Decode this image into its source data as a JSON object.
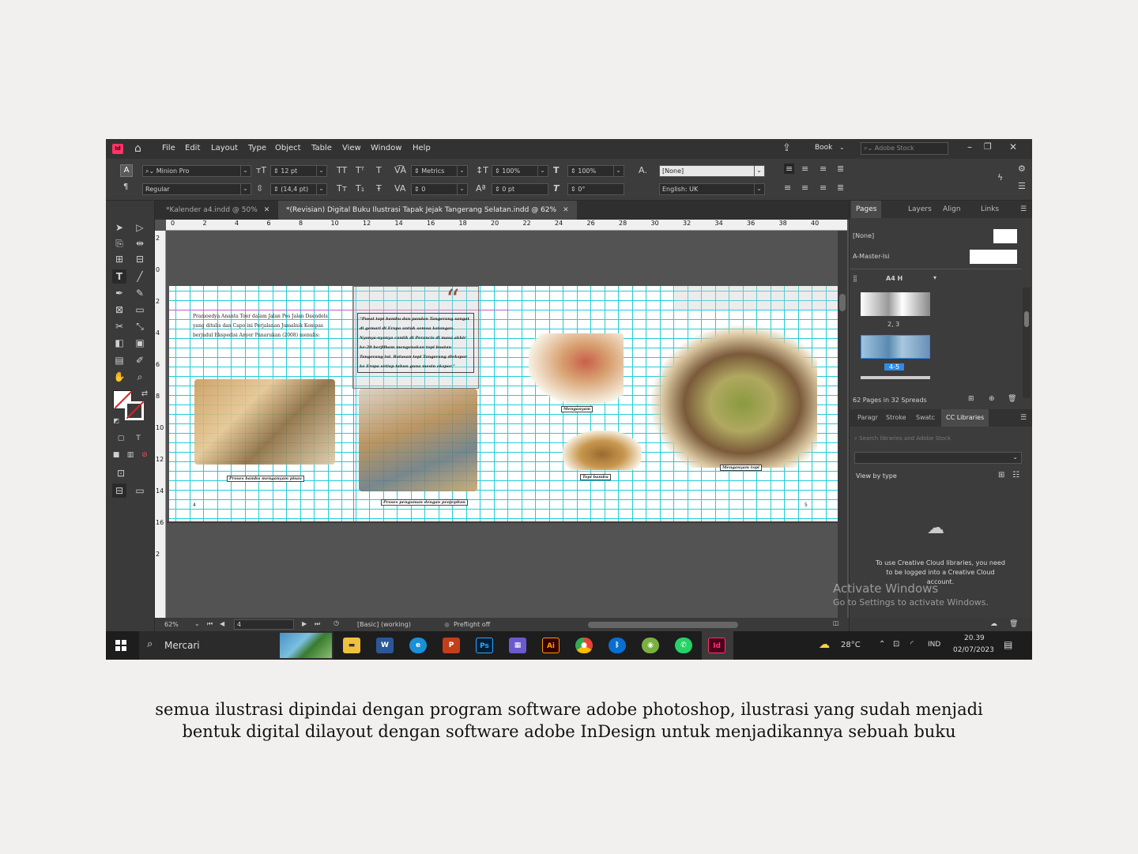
{
  "menubar": {
    "items": [
      "File",
      "Edit",
      "Layout",
      "Type",
      "Object",
      "Table",
      "View",
      "Window",
      "Help"
    ],
    "workspace": "Book",
    "search_placeholder": "Adobe Stock"
  },
  "control": {
    "font_family": "Minion Pro",
    "font_style": "Regular",
    "font_size": "12 pt",
    "leading": "(14,4 pt)",
    "kerning": "Metrics",
    "tracking": "0",
    "vscale": "100%",
    "hscale": "100%",
    "baseline": "0 pt",
    "skew": "0°",
    "char_style": "[None]",
    "language": "English: UK"
  },
  "tabs": {
    "tab1": "*Kalender a4.indd @ 50%",
    "tab2": "*(Revisian) Digital Buku Ilustrasi Tapak Jejak Tangerang Selatan.indd @ 62%"
  },
  "ruler": {
    "h": [
      "0",
      "2",
      "4",
      "6",
      "8",
      "10",
      "12",
      "14",
      "16",
      "18",
      "20",
      "22",
      "24",
      "26",
      "28",
      "30",
      "32",
      "34",
      "36",
      "38",
      "40"
    ],
    "v": [
      "2",
      "0",
      "2",
      "4",
      "6",
      "8",
      "10",
      "12",
      "14",
      "16",
      "2"
    ]
  },
  "document": {
    "body_text": "Pramoedya Ananta Toer dalam Jalan Pos Jalan Daendels yang ditulis dan Capo ini Perjalanan Jumalnik Kompas berjudul Ekspedisi Anyer Panarukan (2008) menulis:",
    "quote_mark": "“",
    "quote": "“Pusat topi bambu dan pandan Tangerang sangat di gemari di Eropa untuk semua kalangan. Nyonya-nyonya cantik di Perancis di masa akhir ke-20 berjilbam mengenakan topi buatan Tangerang ini. Ratusan topi Tangerang diekspor ke Eropa setiap tahun guna mesin ekspor.”",
    "captions": {
      "c1": "Proses bambu menganyam pisau",
      "c2": "Proses penguman dengan penjepitan",
      "c3": "Menganyam",
      "c4": "Topi bambu",
      "c5": "Menganyam topi"
    },
    "page_left": "4",
    "page_right": "5"
  },
  "status": {
    "zoom": "62%",
    "page": "4",
    "style": "[Basic] (working)",
    "preflight": "Preflight off"
  },
  "pages_panel": {
    "tabs": [
      "Pages",
      "Layers",
      "Align",
      "Links"
    ],
    "masters": [
      "[None]",
      "A-Master-Isi"
    ],
    "size": "A4 H",
    "spread_labels": [
      "2, 3",
      "4-5"
    ],
    "summary": "62 Pages in 32 Spreads"
  },
  "lib_panel": {
    "tabs": [
      "Paragr",
      "Stroke",
      "Swatc",
      "CC Libraries"
    ],
    "search_placeholder": "Search libraries and Adobe Stock",
    "view_by": "View by type",
    "message": "To use Creative Cloud libraries, you need to be logged into a Creative Cloud account."
  },
  "watermark": {
    "line1": "Activate Windows",
    "line2": "Go to Settings to activate Windows."
  },
  "taskbar": {
    "search": "Mercari",
    "temp": "28°C",
    "lang": "IND",
    "time": "20.39",
    "date": "02/07/2023",
    "apps": [
      "Ps",
      "Ai",
      "Id"
    ]
  },
  "description": {
    "line1": "semua ilustrasi dipindai dengan program software adobe photoshop,  ilustrasi yang sudah menjadi",
    "line2": "bentuk digital dilayout dengan software adobe InDesign untuk menjadikannya sebuah buku"
  },
  "colors": {
    "grid": "#24cbd6",
    "indesign": "#ff3366",
    "accent": "#2d8ceb"
  }
}
